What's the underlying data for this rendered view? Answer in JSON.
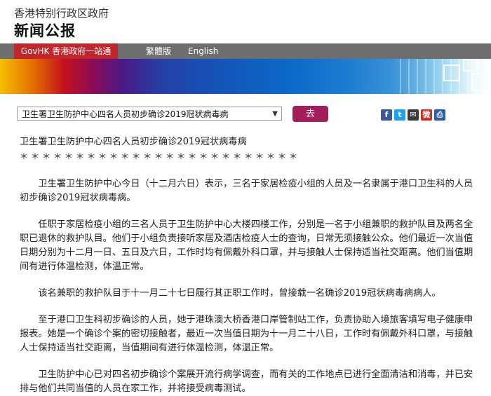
{
  "header": {
    "gov_name": "香港特别行政区政府",
    "press_release": "新闻公报"
  },
  "nav": {
    "govhk": "GovHK 香港政府一站通",
    "traditional": "繁體版",
    "english": "English"
  },
  "selector": {
    "selected": "卫生署卫生防护中心四名人员初步确诊2019冠状病毒病",
    "go_label": "去"
  },
  "share_icons": [
    "facebook-icon",
    "twitter-icon",
    "email-icon",
    "weibo-icon",
    "print-icon"
  ],
  "article": {
    "title": "卫生署卫生防护中心四名人员初步确诊2019冠状病毒病",
    "divider": "＊＊＊＊＊＊＊＊＊＊＊＊＊＊＊＊＊＊＊＊＊＊＊＊＊",
    "paragraphs": [
      "卫生署卫生防护中心今日（十二月六日）表示，三名于家居检疫小组的人员及一名隶属于港口卫生科的人员初步确诊2019冠状病毒病。",
      "任职于家居检疫小组的三名人员于卫生防护中心大楼四楼工作，分别是一名于小组兼职的救护队目及两名全职已退休的救护队目。他们于小组负责接听家居及酒店检疫人士的查询，日常无须接触公众。他们最近一次当值日期分别为十二月一日、五日及六日，工作时均有佩戴外科口罩，并与接触人士保持适当社交距离。他们当值期间有进行体温检测，体温正常。",
      "该名兼职的救护队目于十一月二十七日履行其正职工作时，曾接载一名确诊2019冠状病毒病病人。",
      "至于港口卫生科初步确诊的人员，她于港珠澳大桥香港口岸管制站工作，负责协助入境旅客填写电子健康申报表。她是一个确诊个案的密切接触者，最近一次当值日期为十一月二十八日，工作时有佩戴外科口罩，与接触人士保持适当社交距离，当值期间有进行体温检测，体温正常。",
      "卫生防护中心已对四名初步确诊个案展开流行病学调查，而有关的工作地点已进行全面清洁和消毒，并已安排与他们共同当值的人员在家工作，并将接受病毒测试。"
    ]
  }
}
